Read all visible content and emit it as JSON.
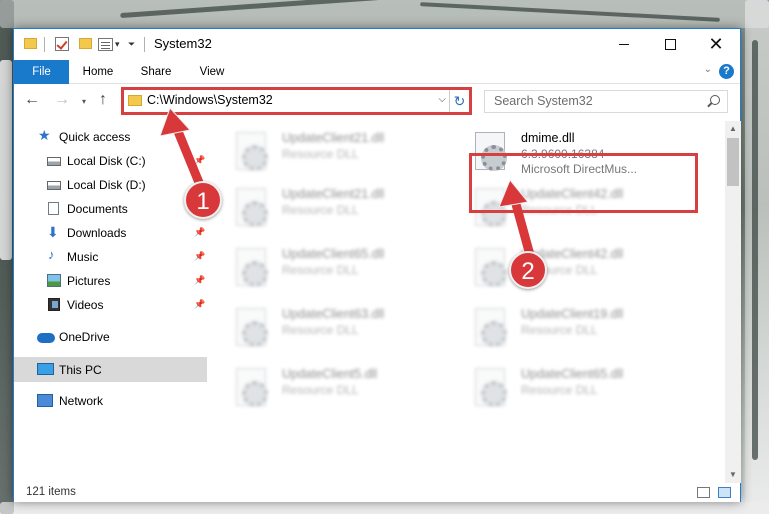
{
  "window": {
    "title": "System32"
  },
  "ribbon": {
    "tabs": [
      "File",
      "Home",
      "Share",
      "View"
    ],
    "help": "?"
  },
  "address": {
    "path": "C:\\Windows\\System32"
  },
  "search": {
    "placeholder": "Search System32"
  },
  "sidebar": {
    "items": [
      {
        "label": "Quick access",
        "icon": "star-icon",
        "pinned": false
      },
      {
        "label": "Local Disk (C:)",
        "icon": "disk-icon",
        "pinned": true
      },
      {
        "label": "Local Disk (D:)",
        "icon": "disk-icon",
        "pinned": false
      },
      {
        "label": "Documents",
        "icon": "documents-icon",
        "pinned": false
      },
      {
        "label": "Downloads",
        "icon": "download-icon",
        "pinned": true
      },
      {
        "label": "Music",
        "icon": "music-icon",
        "pinned": true
      },
      {
        "label": "Pictures",
        "icon": "pictures-icon",
        "pinned": true
      },
      {
        "label": "Videos",
        "icon": "videos-icon",
        "pinned": true
      },
      {
        "label": "OneDrive",
        "icon": "onedrive-icon",
        "pinned": false
      },
      {
        "label": "This PC",
        "icon": "this-pc-icon",
        "pinned": false,
        "selected": true
      },
      {
        "label": "Network",
        "icon": "network-icon",
        "pinned": false
      }
    ]
  },
  "files": [
    {
      "name": "UpdateClient21.dll",
      "line2": "Resource DLL",
      "line3": ""
    },
    {
      "name": "dmime.dll",
      "line2": "6.3.9600.16384",
      "line3": "Microsoft DirectMus..."
    },
    {
      "name": "UpdateClient21.dll",
      "line2": "Resource DLL",
      "line3": ""
    },
    {
      "name": "UpdateClient42.dll",
      "line2": "Resource DLL",
      "line3": ""
    },
    {
      "name": "UpdateClient65.dll",
      "line2": "Resource DLL",
      "line3": ""
    },
    {
      "name": "UpdateClient42.dll",
      "line2": "Resource DLL",
      "line3": ""
    },
    {
      "name": "UpdateClient63.dll",
      "line2": "Resource DLL",
      "line3": ""
    },
    {
      "name": "UpdateClient19.dll",
      "line2": "Resource DLL",
      "line3": ""
    },
    {
      "name": "UpdateClient5.dll",
      "line2": "Resource DLL",
      "line3": ""
    },
    {
      "name": "UpdateClient65.dll",
      "line2": "Resource DLL",
      "line3": ""
    }
  ],
  "status": {
    "item_count": "121 items"
  },
  "annotations": {
    "step1": "1",
    "step2": "2",
    "color": "#d64040"
  }
}
